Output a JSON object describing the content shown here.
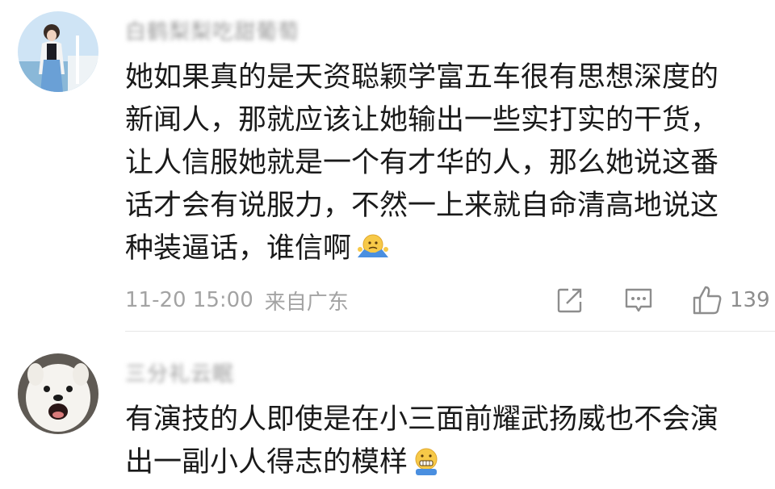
{
  "comments": [
    {
      "username": "白鹤梨梨吃甜葡萄",
      "text": "她如果真的是天资聪颖学富五车很有思想深度的\n新闻人，那就应该让她输出一些实打实的干货，\n让人信服她就是一个有才华的人，那么她说这番\n话才会有说服力，不然一上来就自命清高地说这\n种装逼话，谁信啊",
      "emoji": "shrug-emoji",
      "time": "11-20 15:00",
      "location": "来自广东",
      "likes": "139"
    },
    {
      "username": "三分礼云眠",
      "text": "有演技的人即使是在小三面前耀武扬威也不会演\n出一副小人得志的模样",
      "emoji": "grimace-emoji"
    }
  ],
  "colors": {
    "text": "#1a1a1a",
    "meta": "#a3a3a3",
    "icon": "#8d8d8d",
    "divider": "#e6e6e6"
  }
}
